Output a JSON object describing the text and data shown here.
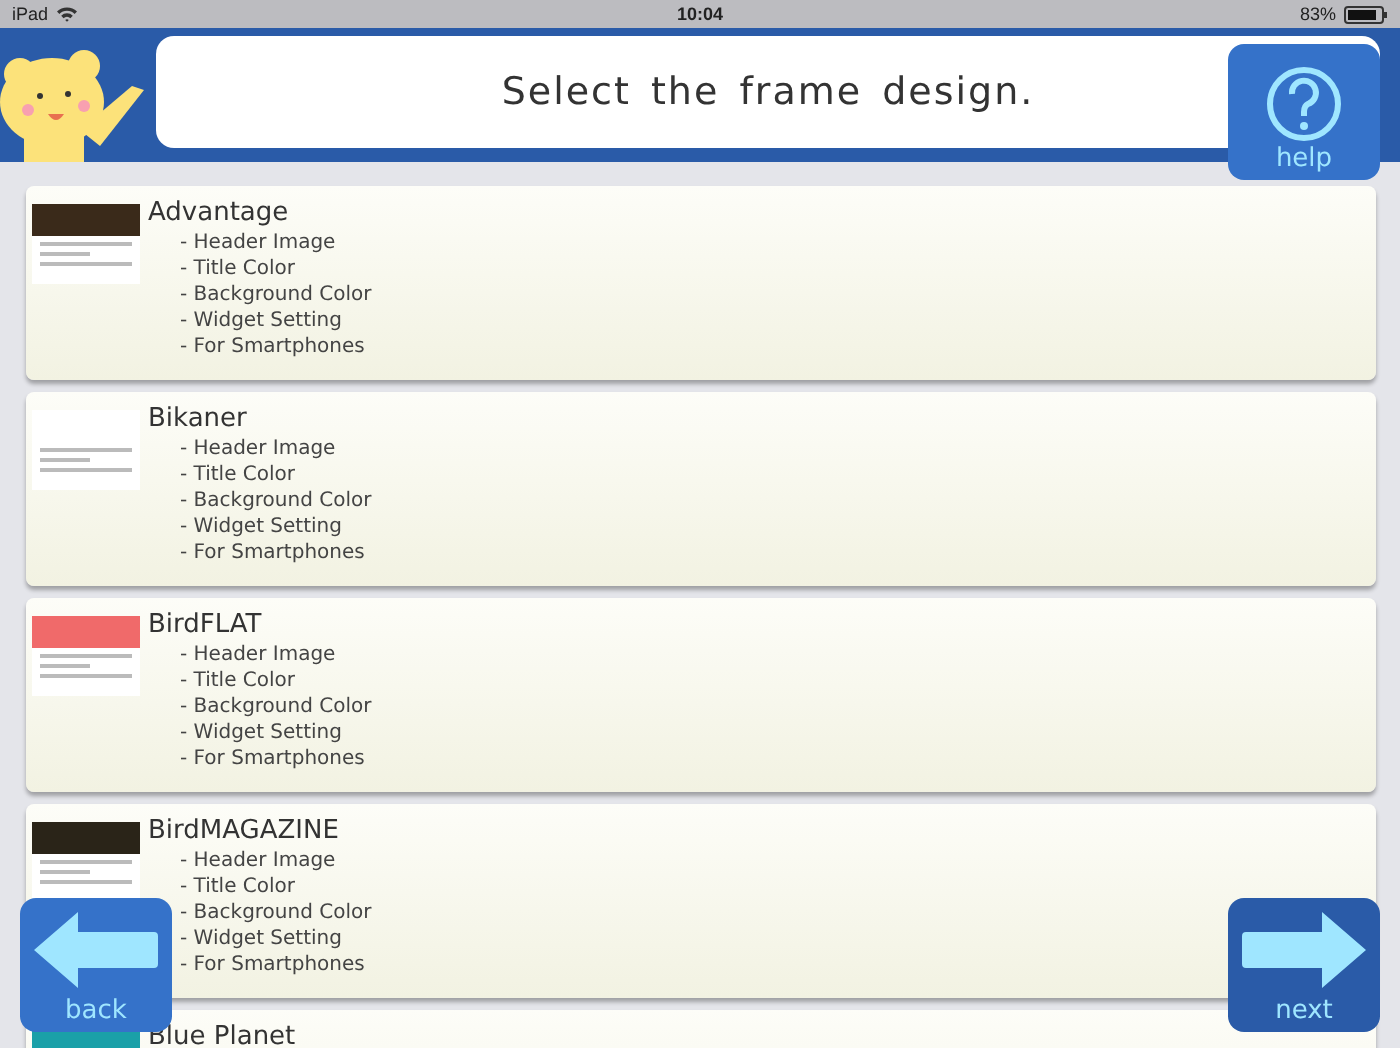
{
  "status_bar": {
    "device": "iPad",
    "time": "10:04",
    "battery": "83%"
  },
  "header": {
    "title": "Select the frame design.",
    "help_label": "help"
  },
  "designs": [
    {
      "name": "Advantage",
      "color": "#3a2a1a",
      "features": [
        "- Header Image",
        "- Title Color",
        "- Background Color",
        "- Widget Setting",
        "- For Smartphones"
      ]
    },
    {
      "name": "Bikaner",
      "color": "#ffffff",
      "features": [
        "- Header Image",
        "- Title Color",
        "- Background Color",
        "- Widget Setting",
        "- For Smartphones"
      ]
    },
    {
      "name": "BirdFLAT",
      "color": "#f06a6a",
      "features": [
        "- Header Image",
        "- Title Color",
        "- Background Color",
        "- Widget Setting",
        "- For Smartphones"
      ]
    },
    {
      "name": "BirdMAGAZINE",
      "color": "#2a2418",
      "features": [
        "- Header Image",
        "- Title Color",
        "- Background Color",
        "- Widget Setting",
        "- For Smartphones"
      ]
    },
    {
      "name": "Blue Planet",
      "color": "#1aa0a8"
    }
  ],
  "nav": {
    "back_label": "back",
    "next_label": "next"
  }
}
